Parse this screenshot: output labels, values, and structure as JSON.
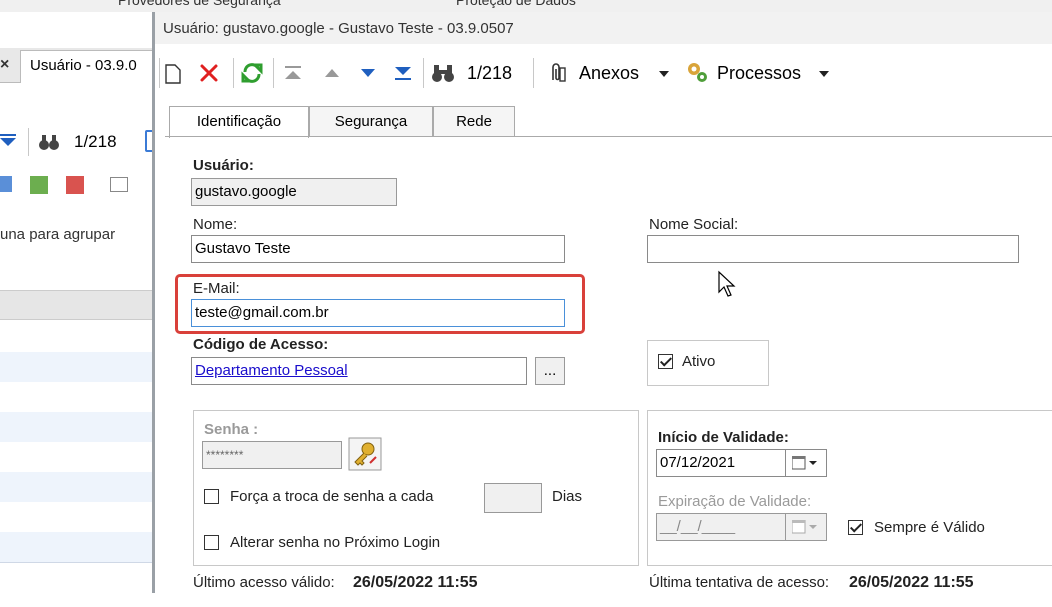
{
  "background_app": {
    "top_labels": [
      "Provedores de Segurança",
      "Proteção de Dados"
    ],
    "tab_label": "Usuário - 03.9.0",
    "tab_close": "×",
    "record_counter": "1/218",
    "group_hint": "una para agrupar"
  },
  "dialog": {
    "title": "Usuário: gustavo.google - Gustavo Teste - 03.9.0507",
    "toolbar": {
      "record_counter": "1/218",
      "anexos_label": "Anexos",
      "processos_label": "Processos"
    },
    "tabs": [
      {
        "label": "Identificação",
        "active": true
      },
      {
        "label": "Segurança",
        "active": false
      },
      {
        "label": "Rede",
        "active": false
      }
    ],
    "form": {
      "usuario_label": "Usuário:",
      "usuario_value": "gustavo.google",
      "nome_label": "Nome:",
      "nome_value": "Gustavo Teste",
      "nome_social_label": "Nome Social:",
      "nome_social_value": "",
      "email_label": "E-Mail:",
      "email_value": "teste@gmail.com.br",
      "codigo_label": "Código de Acesso:",
      "codigo_value": "Departamento Pessoal",
      "codigo_browse": "...",
      "ativo_label": "Ativo",
      "ativo_checked": true,
      "senha_label": "Senha :",
      "senha_value": "********",
      "forca_troca_label": "Força a troca de senha a cada",
      "forca_troca_checked": false,
      "dias_value": "",
      "dias_label": "Dias",
      "alterar_senha_label": "Alterar senha no Próximo Login",
      "alterar_senha_checked": false,
      "inicio_validade_label": "Início de Validade:",
      "inicio_validade_value": "07/12/2021",
      "expiracao_label": "Expiração de Validade:",
      "expiracao_value": "__/__/____",
      "sempre_valido_label": "Sempre é Válido",
      "sempre_valido_checked": true,
      "ultimo_acesso_label": "Último acesso válido:",
      "ultimo_acesso_value": "26/05/2022 11:55",
      "ultima_tentativa_label": "Última tentativa de acesso:",
      "ultima_tentativa_value": "26/05/2022 11:55"
    }
  },
  "colors": {
    "highlight_border": "#d9403a",
    "link": "#1a0dcc",
    "focus_border": "#4a90d9"
  }
}
